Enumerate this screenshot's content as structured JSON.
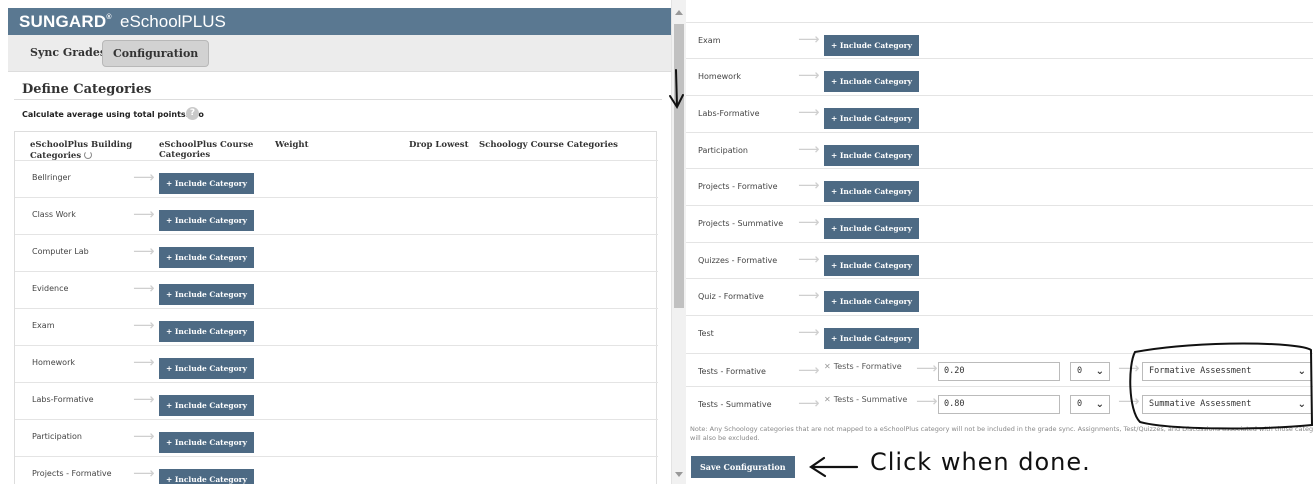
{
  "app": {
    "brand_strong": "SUNGARD",
    "brand_mark": "®",
    "brand_light": "eSchoolPLUS"
  },
  "tabs": [
    {
      "label": "Sync Grades"
    },
    {
      "label": "Configuration"
    }
  ],
  "section": {
    "title": "Define Categories",
    "calc_label": "Calculate average using total points: No",
    "help_icon_label": "?"
  },
  "table": {
    "headers": {
      "building": "eSchoolPlus Building Categories",
      "course": "eSchoolPlus Course Categories",
      "weight": "Weight",
      "drop_lowest": "Drop Lowest",
      "schoology": "Schoology Course Categories"
    },
    "left_rows": [
      "Bellringer",
      "Class Work",
      "Computer Lab",
      "Evidence",
      "Exam",
      "Homework",
      "Labs-Formative",
      "Participation",
      "Projects - Formative"
    ],
    "include_label": "+ Include Category",
    "right_rows": [
      {
        "name": "Exam"
      },
      {
        "name": "Homework"
      },
      {
        "name": "Labs-Formative"
      },
      {
        "name": "Participation"
      },
      {
        "name": "Projects - Formative"
      },
      {
        "name": "Projects - Summative"
      },
      {
        "name": "Quizzes - Formative"
      },
      {
        "name": "Quiz - Formative"
      },
      {
        "name": "Test"
      },
      {
        "name": "Tests - Formative",
        "mapped": "Tests - Formative",
        "weight": "0.20",
        "drop_lowest": "0",
        "schoology": "Formative Assessment"
      },
      {
        "name": "Tests - Summative",
        "mapped": "Tests - Summative",
        "weight": "0.80",
        "drop_lowest": "0",
        "schoology": "Summative Assessment"
      }
    ]
  },
  "note": "Note: Any Schoology categories that are not mapped to a eSchoolPlus category will not be included in the grade sync. Assignments, Test/Quizzes, and Discussions associated with those categories will also be excluded.",
  "save_label": "Save Configuration",
  "annotation": {
    "text": "Click when done."
  },
  "colors": {
    "brand_bar": "#5a7891",
    "button": "#4d6a84",
    "annotation_ink": "#111111"
  }
}
